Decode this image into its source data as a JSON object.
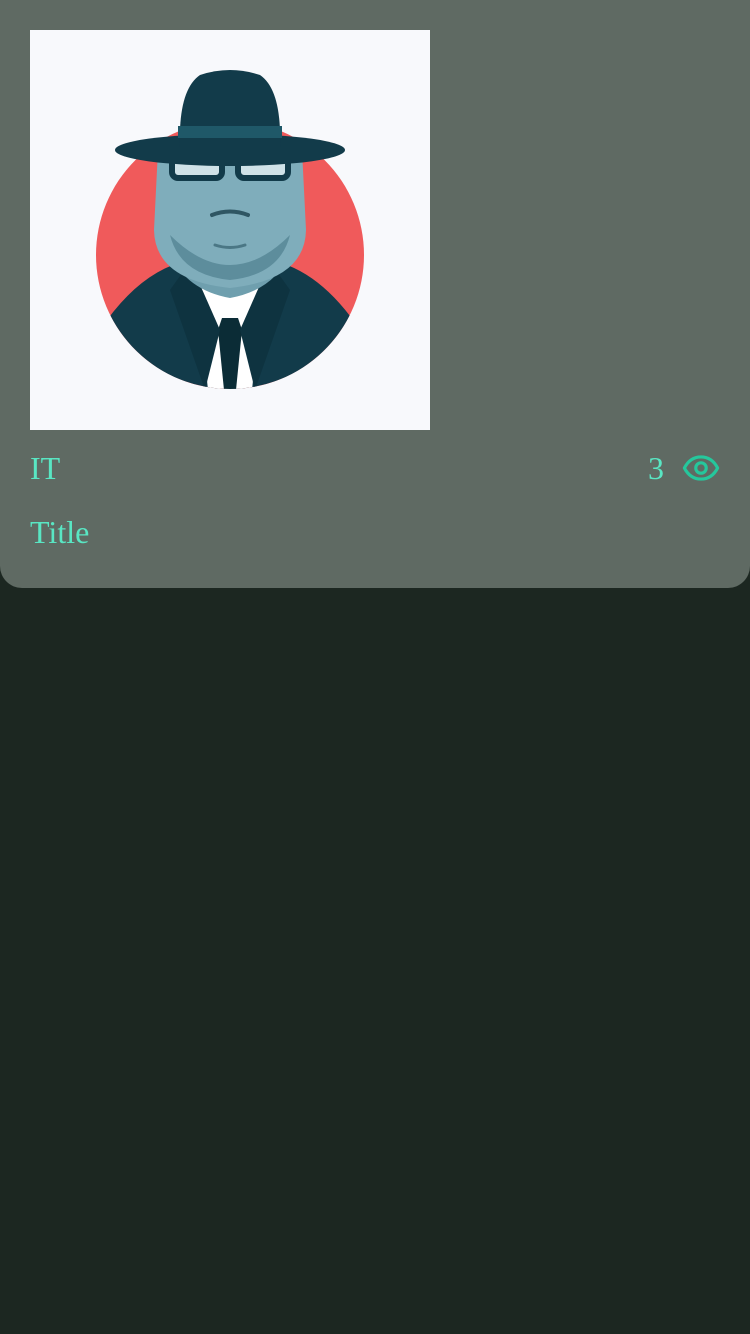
{
  "colors": {
    "accent": "#59e6c3",
    "icon_accent": "#25c79c",
    "card_bg": "#5f6a63",
    "page_bg": "#1c2721"
  },
  "card": {
    "image_alt": "detective-avatar",
    "category": "IT",
    "views_count": "3",
    "views_icon": "eye-icon",
    "title": "Title"
  }
}
